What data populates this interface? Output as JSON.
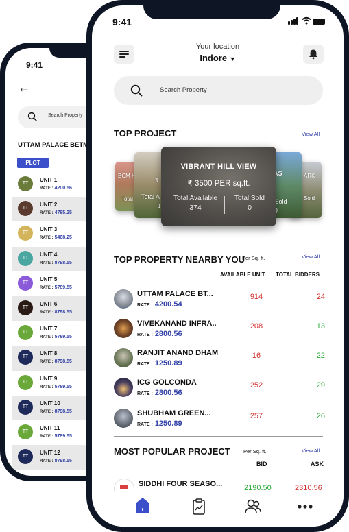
{
  "colors": {
    "accent": "#3342a8",
    "red": "#d0312d",
    "green": "#26a834",
    "plot_badge": "#3a4fc9",
    "frame": "#0e1626"
  },
  "back_screen": {
    "time": "9:41",
    "search_placeholder": "Search Property",
    "project_title": "UTTAM PALACE BETMA",
    "plot_tab": "PLOT",
    "units": [
      {
        "initials": "TT",
        "name": "UNIT 1",
        "rate_label": "RATE :",
        "rate": "4200.56",
        "color": "#6b7b3a"
      },
      {
        "initials": "TT",
        "name": "UNIT 2",
        "rate_label": "RATE :",
        "rate": "4785.25",
        "color": "#5a3a2e"
      },
      {
        "initials": "TT",
        "name": "UNIT 3",
        "rate_label": "RATE :",
        "rate": "5468.25",
        "color": "#d4b45a"
      },
      {
        "initials": "TT",
        "name": "UNIT 4",
        "rate_label": "RATE :",
        "rate": "8798.55",
        "color": "#4aa6a0"
      },
      {
        "initials": "TT",
        "name": "UNIT 5",
        "rate_label": "RATE :",
        "rate": "5789.55",
        "color": "#8a5ad8"
      },
      {
        "initials": "TT",
        "name": "UNIT 6",
        "rate_label": "RATE :",
        "rate": "8798.55",
        "color": "#2a1a14"
      },
      {
        "initials": "TT",
        "name": "UNIT 7",
        "rate_label": "RATE :",
        "rate": "5789.55",
        "color": "#6aa83a"
      },
      {
        "initials": "TT",
        "name": "UNIT 8",
        "rate_label": "RATE :",
        "rate": "8798.55",
        "color": "#1e2a5a"
      },
      {
        "initials": "TT",
        "name": "UNIT 9",
        "rate_label": "RATE :",
        "rate": "5789.55",
        "color": "#6aa83a"
      },
      {
        "initials": "TT",
        "name": "UNIT 10",
        "rate_label": "RATE :",
        "rate": "8798.55",
        "color": "#1e2a5a"
      },
      {
        "initials": "TT",
        "name": "UNIT 11",
        "rate_label": "RATE :",
        "rate": "5789.55",
        "color": "#6aa83a"
      },
      {
        "initials": "TT",
        "name": "UNIT 12",
        "rate_label": "RATE :",
        "rate": "8798.55",
        "color": "#1e2a5a"
      }
    ]
  },
  "front_screen": {
    "time": "9:41",
    "location_label": "Your location",
    "city": "Indore",
    "search_placeholder": "Search Property",
    "top_project": {
      "title": "TOP PROJECT",
      "view_all": "View All",
      "side_cards": {
        "c1_label": "BCM H",
        "c1_sub": "Total",
        "c2_label": "₹",
        "c2_sub": "Total A",
        "c2_val": "1",
        "c4_label": "AS",
        "c4_sub": "al Sold",
        "c4_val": "79",
        "c5_label": "ARK",
        "c5_sub": "Sold"
      },
      "featured": {
        "name": "VIBRANT HILL VIEW",
        "price": "₹ 3500 PER sq.ft.",
        "total_available_label": "Total Available",
        "total_available": "374",
        "total_sold_label": "Total Sold",
        "total_sold": "0"
      }
    },
    "nearby": {
      "title": "TOP PROPERTY NEARBY YOU",
      "per_sqft": "Per Sq. ft.",
      "view_all": "View All",
      "col_available": "AVAILABLE UNIT",
      "col_bidders": "TOTAL BIDDERS",
      "rate_label": "RATE :",
      "items": [
        {
          "name": "UTTAM PALACE BT...",
          "rate": "4200.54",
          "available": "914",
          "bidders": "24",
          "bidders_color": "red"
        },
        {
          "name": "VIVEKANAND INFRA..",
          "rate": "2800.56",
          "available": "208",
          "bidders": "13",
          "bidders_color": "green"
        },
        {
          "name": "RANJIT ANAND DHAM",
          "rate": "1250.89",
          "available": "16",
          "bidders": "22",
          "bidders_color": "green"
        },
        {
          "name": "ICG GOLCONDA",
          "rate": "2800.56",
          "available": "252",
          "bidders": "29",
          "bidders_color": "green"
        },
        {
          "name": "SHUBHAM GREEN...",
          "rate": "1250.89",
          "available": "257",
          "bidders": "26",
          "bidders_color": "green"
        }
      ]
    },
    "popular": {
      "title": "MOST POPULAR PROJECT",
      "per_sqft": "Per Sq. ft.",
      "view_all": "View All",
      "col_bid": "BID",
      "col_ask": "ASK",
      "items": [
        {
          "name": "SIDDHI FOUR SEASO...",
          "bid": "2190.50",
          "ask": "2310.56"
        }
      ]
    },
    "bottom_nav": [
      "home-icon",
      "clipboard-chart-icon",
      "users-icon",
      "more-dots-icon"
    ]
  }
}
